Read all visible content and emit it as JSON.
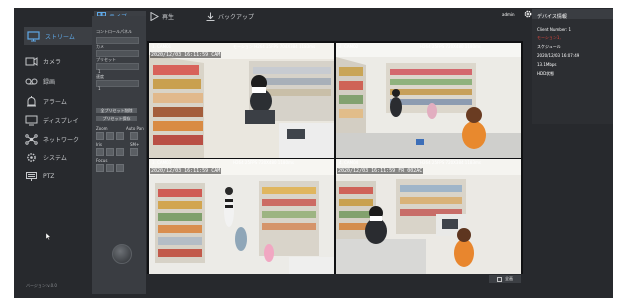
{
  "nav": {
    "items": [
      {
        "label": "ストリーム",
        "icon": "monitor-icon"
      },
      {
        "label": "カメラ",
        "icon": "camera-icon"
      },
      {
        "label": "録画",
        "icon": "tape-icon"
      },
      {
        "label": "アラーム",
        "icon": "alarm-icon"
      },
      {
        "label": "ディスプレイ",
        "icon": "display-icon"
      },
      {
        "label": "ネットワーク",
        "icon": "network-icon"
      },
      {
        "label": "システム",
        "icon": "system-icon"
      },
      {
        "label": "PTZ",
        "icon": "ptz-icon"
      }
    ],
    "version": "バージョン:v.0.0"
  },
  "top": {
    "tabs": [
      {
        "label": "ライブ",
        "icon": "grid-icon"
      },
      {
        "label": "再生",
        "icon": "play-icon"
      },
      {
        "label": "バックアップ",
        "icon": "download-icon"
      }
    ],
    "user": "admin"
  },
  "panel": {
    "rows": [
      {
        "label": "コントロールパネル"
      },
      {
        "label": "カメ"
      },
      {
        "label": "プリセット"
      },
      {
        "label": "1"
      },
      {
        "label": "速度"
      },
      {
        "label": "1"
      }
    ],
    "buttons": [
      "全プリセット削除",
      "プリセット保存"
    ],
    "zoom_label": "Zoom",
    "autopan_label": "Auto Pan",
    "iris_label": "Iris",
    "speed_label": "SM+",
    "focus_label": "Focus"
  },
  "cameras": [
    {
      "title": "1. CAM01",
      "info": "モーション  H264 25FPS 704X384 1183ms",
      "timestamp": "2020/12/03 16:11:59",
      "overlay": "CAM"
    },
    {
      "title": "2. CAM02",
      "info": "H264 25FPS 720X480 1180ms",
      "timestamp": "",
      "overlay": ""
    },
    {
      "title": "3. CAM03",
      "info": "H264 25FPS 720X480 1180ms",
      "timestamp": "2020/12/03 16:11:59",
      "overlay": "CAM"
    },
    {
      "title": "4. CAM04",
      "info": "H264 25FPS 720X384 1183ms",
      "timestamp": "2020/12/03 16:11:59",
      "overlay": "FR 002AC"
    }
  ],
  "fullscreen_label": "全画",
  "device_info": {
    "header": "デバイス情報",
    "client_number": "Client Number: 1",
    "motion": "モーション1,",
    "schedule": "スケジュール",
    "datetime": "2020/12/03 16:07:49",
    "bitrate": "13.1Mbps",
    "storage": "HDD状態"
  },
  "colors": {
    "accent": "#5fa9e8",
    "alert": "#e0463d",
    "background": "#27292d"
  }
}
